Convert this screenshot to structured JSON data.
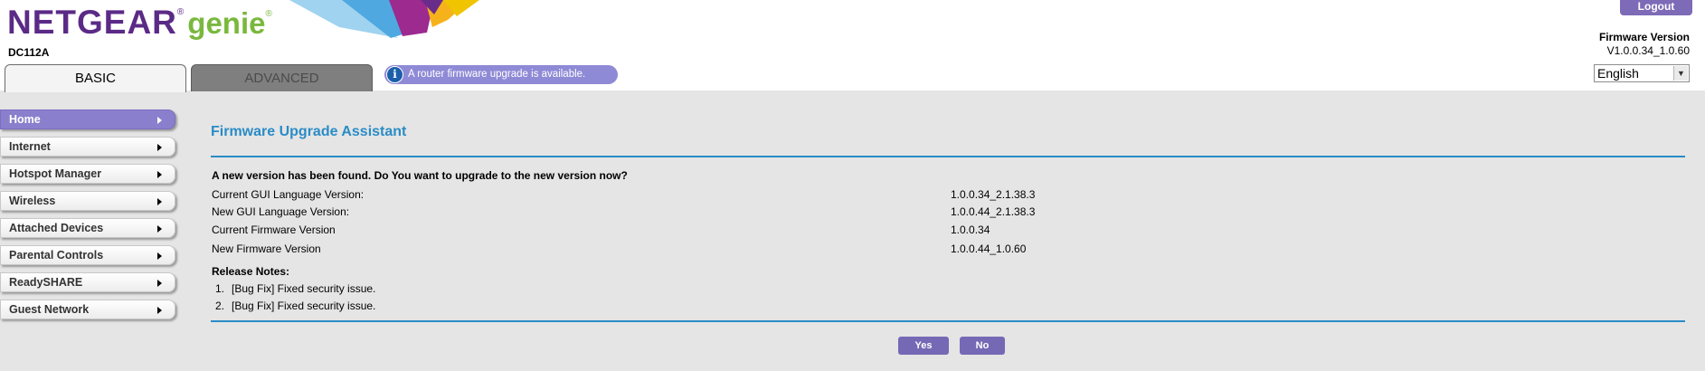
{
  "header": {
    "brand": "NETGEAR",
    "reg_mark": "®",
    "product": "genie",
    "model": "DC112A",
    "tabs": [
      {
        "label": "BASIC"
      },
      {
        "label": "ADVANCED"
      }
    ],
    "firmware_notice": "A router firmware upgrade is available.",
    "logout_label": "Logout",
    "firmware_label": "Firmware Version",
    "firmware_version": "V1.0.0.34_1.0.60",
    "language": "English",
    "brand_colors": {
      "purple": "#5b2a86",
      "green": "#7ab83d"
    }
  },
  "sidebar": {
    "items": [
      {
        "label": "Home",
        "active": true
      },
      {
        "label": "Internet"
      },
      {
        "label": "Hotspot Manager"
      },
      {
        "label": "Wireless"
      },
      {
        "label": "Attached Devices"
      },
      {
        "label": "Parental Controls"
      },
      {
        "label": "ReadySHARE"
      },
      {
        "label": "Guest Network"
      }
    ]
  },
  "main": {
    "title": "Firmware Upgrade Assistant",
    "question": "A new version has been found. Do You want to upgrade to the new version now?",
    "details": [
      {
        "label": "Current GUI Language Version:",
        "value": "1.0.0.34_2.1.38.3"
      },
      {
        "label": "New GUI Language Version:",
        "value": "1.0.0.44_2.1.38.3"
      },
      {
        "label": "Current Firmware Version",
        "value": "1.0.0.34"
      },
      {
        "label": "New Firmware Version",
        "value": "1.0.0.44_1.0.60"
      }
    ],
    "release_notes_label": "Release Notes:",
    "release_notes": [
      {
        "num": "1.",
        "text": "[Bug Fix] Fixed security issue."
      },
      {
        "num": "2.",
        "text": "[Bug Fix] Fixed security issue."
      }
    ],
    "yes_label": "Yes",
    "no_label": "No"
  },
  "colors": {
    "accent_blue": "#2a8cc6",
    "button_purple": "#7569b5",
    "active_nav": "#8a7fcc"
  }
}
